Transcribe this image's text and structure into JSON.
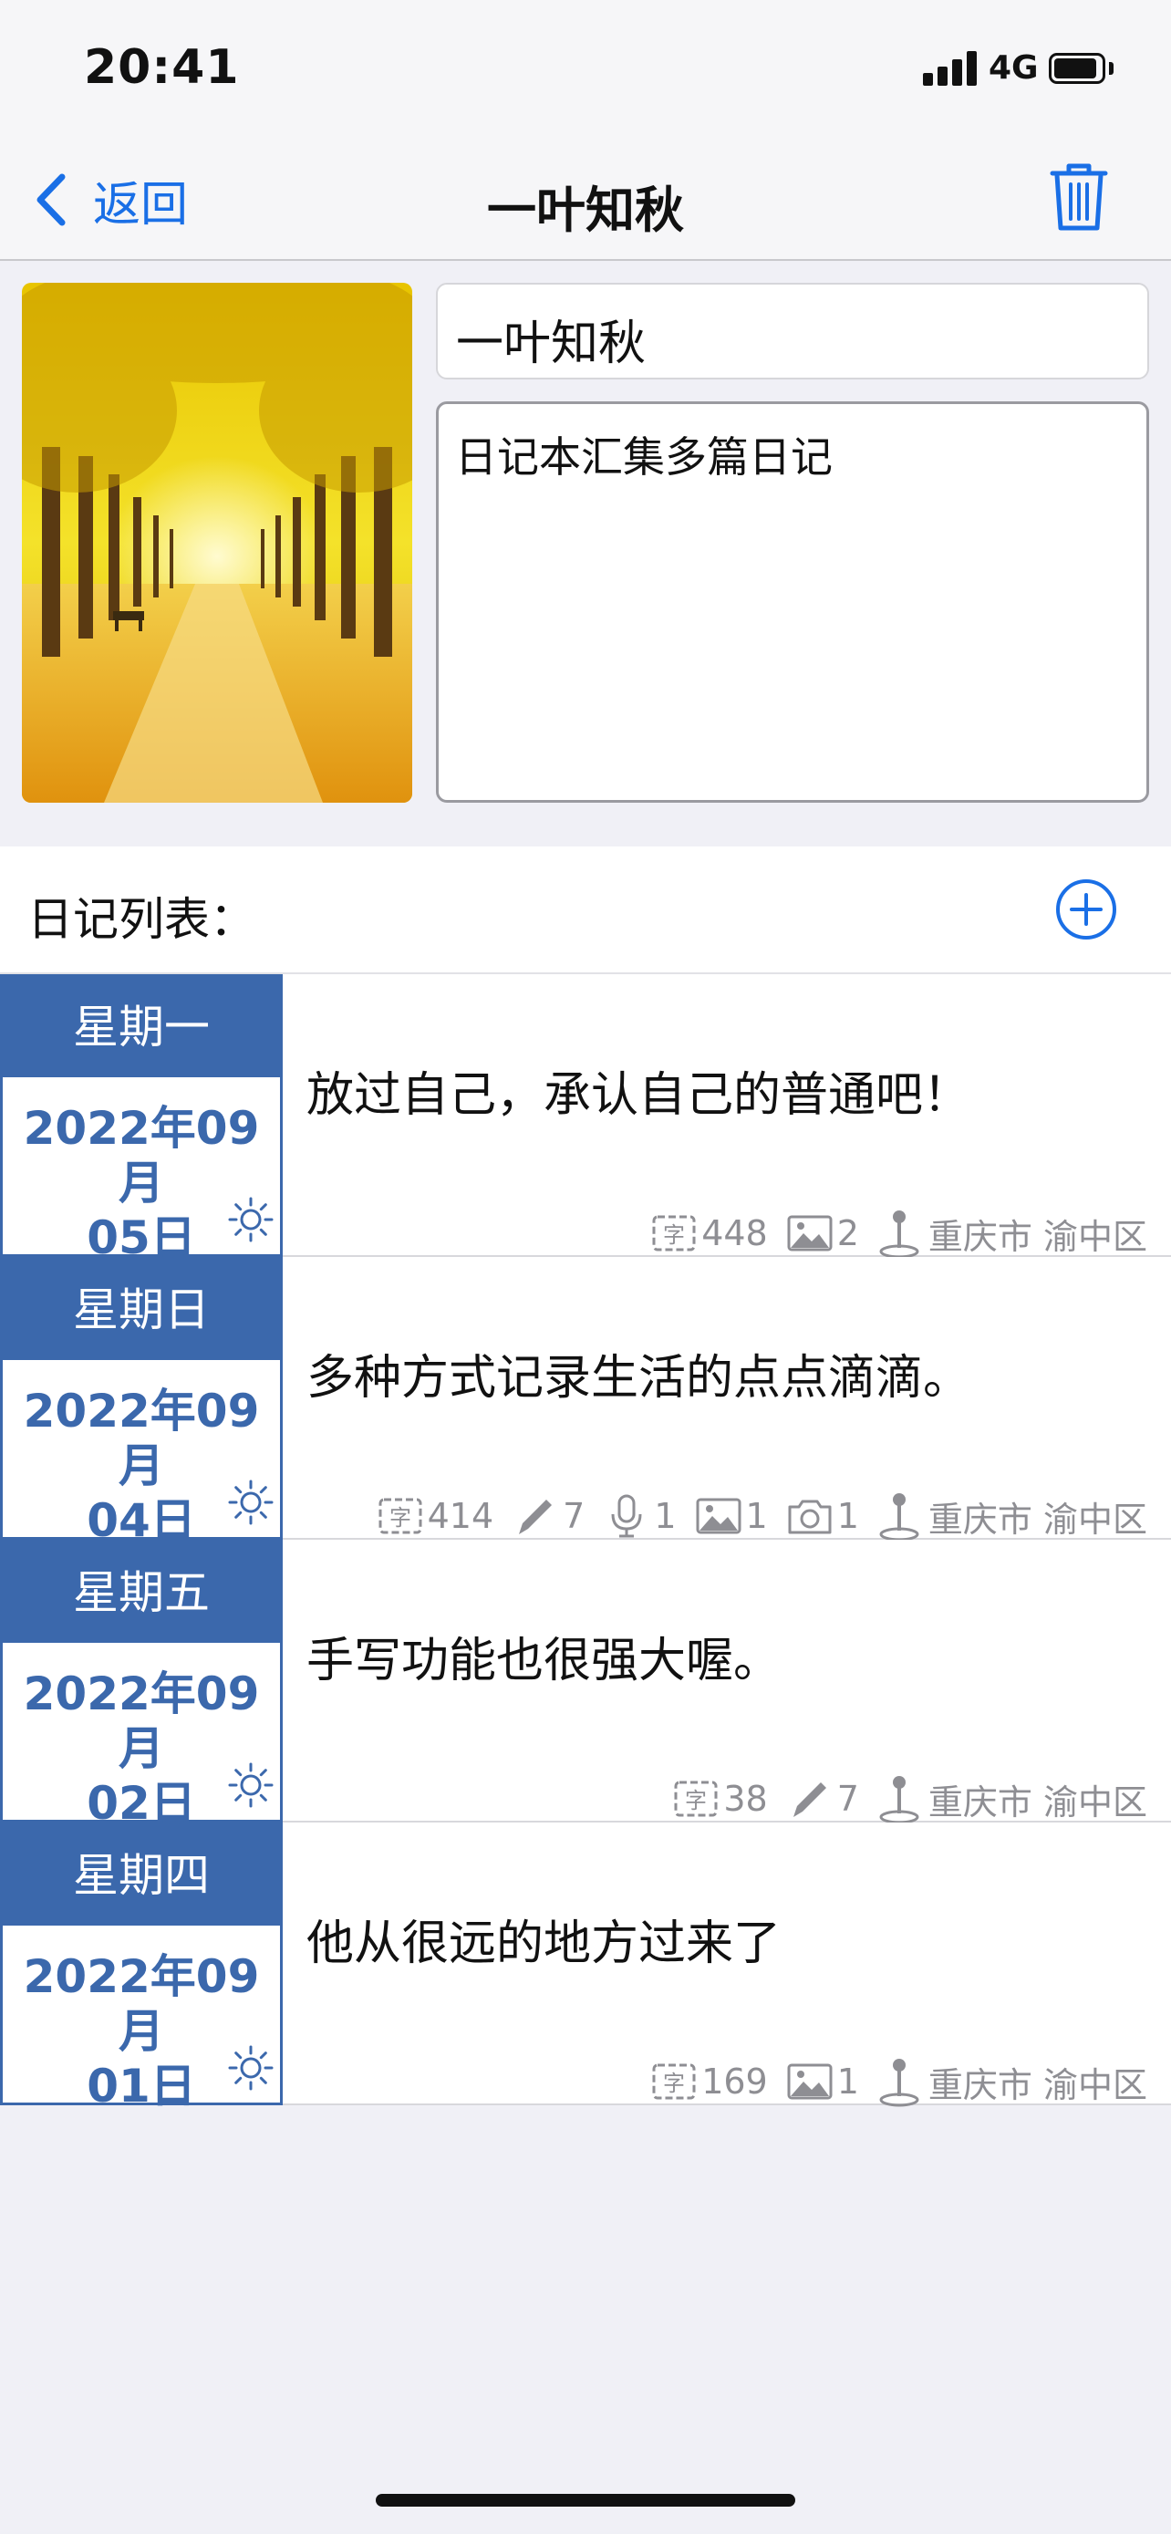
{
  "status_bar": {
    "time": "20:41",
    "network": "4G"
  },
  "nav": {
    "back_label": "返回",
    "title": "一叶知秋"
  },
  "notebook": {
    "title_value": "一叶知秋",
    "description_value": "日记本汇集多篇日记"
  },
  "list": {
    "title": "日记列表：",
    "entries": [
      {
        "weekday": "星期一",
        "date_line1": "2022年09月",
        "date_line2": "05日",
        "text": "放过自己，承认自己的普通吧！",
        "words": "448",
        "images": "2",
        "location": "重庆市 渝中区"
      },
      {
        "weekday": "星期日",
        "date_line1": "2022年09月",
        "date_line2": "04日",
        "text": "多种方式记录生活的点点滴滴。",
        "words": "414",
        "drawings": "7",
        "audio": "1",
        "images": "1",
        "photos": "1",
        "location": "重庆市 渝中区"
      },
      {
        "weekday": "星期五",
        "date_line1": "2022年09月",
        "date_line2": "02日",
        "text": "手写功能也很强大喔。",
        "words": "38",
        "drawings": "7",
        "location": "重庆市 渝中区"
      },
      {
        "weekday": "星期四",
        "date_line1": "2022年09月",
        "date_line2": "01日",
        "text": "他从很远的地方过来了",
        "words": "169",
        "images": "1",
        "location": "重庆市 渝中区"
      }
    ]
  },
  "colors": {
    "accent": "#1a6fe6",
    "date_blue": "#3b68ac",
    "meta_gray": "#8e8e93"
  }
}
